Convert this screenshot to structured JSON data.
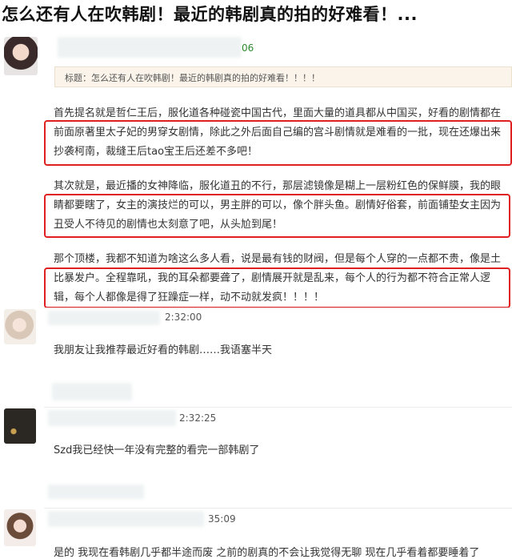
{
  "headline": "怎么还有人在吹韩剧！最近的韩剧真的拍的好难看！...",
  "post": {
    "time_fragment": "06",
    "quote": "标题：怎么还有人在吹韩剧！最近的韩剧真的拍的好难看！！！！",
    "lines": [
      "首先提名就是哲仁王后，服化道各种碰瓷中国古代，里面大量的道具都从中国买，好看的剧情都在",
      "前面原著里太子妃的男穿女剧情，除此之外后面自己编的宫斗剧情就是难看的一批，现在还爆出来",
      "抄袭柯南，裁缝王后tao宝王后还差不多吧！",
      "其次就是，最近播的女神降临，服化道丑的不行，那层滤镜像是糊上一层粉红色的保鲜膜，我的眼",
      "睛都要瞎了，女主的演技烂的可以，男主胖的可以，像个胖头鱼。剧情好俗套，前面铺垫女主因为",
      "丑受人不待见的剧情也太刻意了吧，从头尬到尾！",
      "那个顶楼，我都不知道为啥这么多人看，说是最有钱的财阀，但是每个人穿的一点都不贵，像是土",
      "比暴发户。全程靠吼，我的耳朵都要聋了，剧情展开就是乱来，每个人的行为都不符合正常人逻",
      "辑，每个人都像是得了狂躁症一样，动不动就发疯！！！！"
    ]
  },
  "comments": [
    {
      "time": "2:32:00",
      "text": "我朋友让我推荐最近好看的韩剧……我语塞半天"
    },
    {
      "time": "2:32:25",
      "text": "Szd我已经快一年没有完整的看完一部韩剧了"
    },
    {
      "time": "35:09",
      "text": "是的 我现在看韩剧几乎都半途而废 之前的剧真的不会让我觉得无聊 现在几乎看着都要睡着了"
    }
  ]
}
